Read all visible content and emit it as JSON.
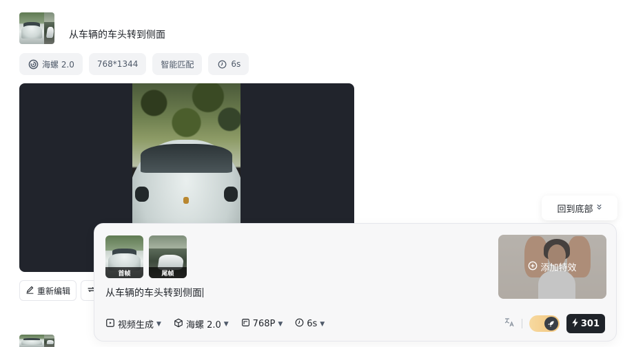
{
  "task": {
    "prompt": "从车辆的车头转到侧面",
    "tags": {
      "model": "海螺 2.0",
      "resolution": "768*1344",
      "mode": "智能匹配",
      "duration": "6s"
    },
    "actions": {
      "re_edit": "重新编辑"
    }
  },
  "back_to_bottom": "回到底部",
  "composer": {
    "first_frame_label": "首帧",
    "last_frame_label": "尾帧",
    "input_value": "从车辆的车头转到侧面",
    "add_effect": "添加特效",
    "toolbar": {
      "type": "视频生成",
      "model": "海螺 2.0",
      "resolution": "768P",
      "duration": "6s"
    },
    "credits": "301"
  },
  "icons": [
    "model-spiral-icon",
    "clock-icon",
    "edit-icon",
    "regenerate-icon",
    "chevron-down-double-icon",
    "plus-circle-icon",
    "video-gen-icon",
    "cube-icon",
    "aspect-icon",
    "translate-icon",
    "rocket-icon",
    "lightning-icon"
  ],
  "colors": {
    "accent_dark": "#1f2329",
    "tag_bg": "#f2f3f5",
    "video_bg": "#21242c",
    "toggle": "#f2c57c"
  }
}
